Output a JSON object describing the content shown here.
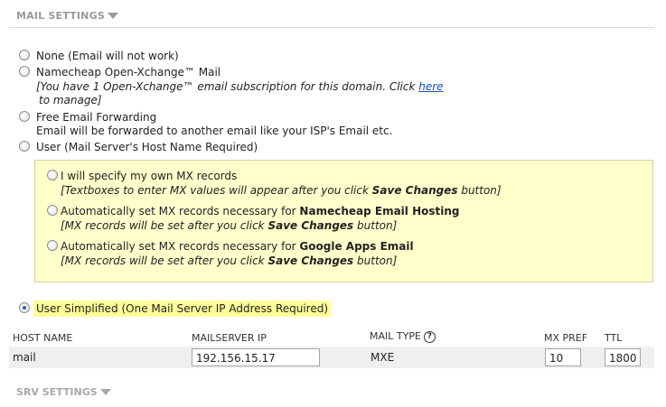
{
  "mail_settings": {
    "title": "MAIL SETTINGS",
    "options": [
      {
        "label": "None (Email will not work)"
      },
      {
        "label": "Namecheap Open-Xchange™ Mail",
        "desc_prefix": "[You have 1 Open-Xchange™ email subscription for this domain. Click ",
        "desc_link": "here",
        "desc_suffix": "to manage]"
      },
      {
        "label": "Free Email Forwarding",
        "desc": "Email will be forwarded to another email like your ISP's Email etc."
      },
      {
        "label": "User (Mail Server's Host Name Required)"
      }
    ],
    "mx_options": [
      {
        "label": "I will specify my own MX records",
        "desc_pre": "[Textboxes to enter MX values will appear after you click ",
        "desc_bold": "Save Changes",
        "desc_post": " button]"
      },
      {
        "label_pre": "Automatically set MX records necessary for ",
        "label_bold": "Namecheap Email Hosting",
        "desc_pre": "[MX records will be set after you click ",
        "desc_bold": "Save Changes",
        "desc_post": " button]"
      },
      {
        "label_pre": "Automatically set MX records necessary for ",
        "label_bold": "Google Apps Email",
        "desc_pre": "[MX records will be set after you click ",
        "desc_bold": "Save Changes",
        "desc_post": " button]"
      }
    ],
    "user_simplified": {
      "label": "User Simplified (One Mail Server IP Address Required)",
      "selected": true
    }
  },
  "table": {
    "headers": {
      "host": "HOST NAME",
      "ip": "MAILSERVER IP",
      "type": "MAIL TYPE",
      "pref": "MX PREF",
      "ttl": "TTL"
    },
    "row": {
      "host": "mail",
      "ip": "192.156.15.17",
      "type": "MXE",
      "pref": "10",
      "ttl": "1800"
    }
  },
  "srv_settings": {
    "title": "SRV SETTINGS"
  },
  "colors": {
    "accent_link": "#1a4fb0",
    "highlight": "#ffff99",
    "box": "#ffffcc"
  }
}
